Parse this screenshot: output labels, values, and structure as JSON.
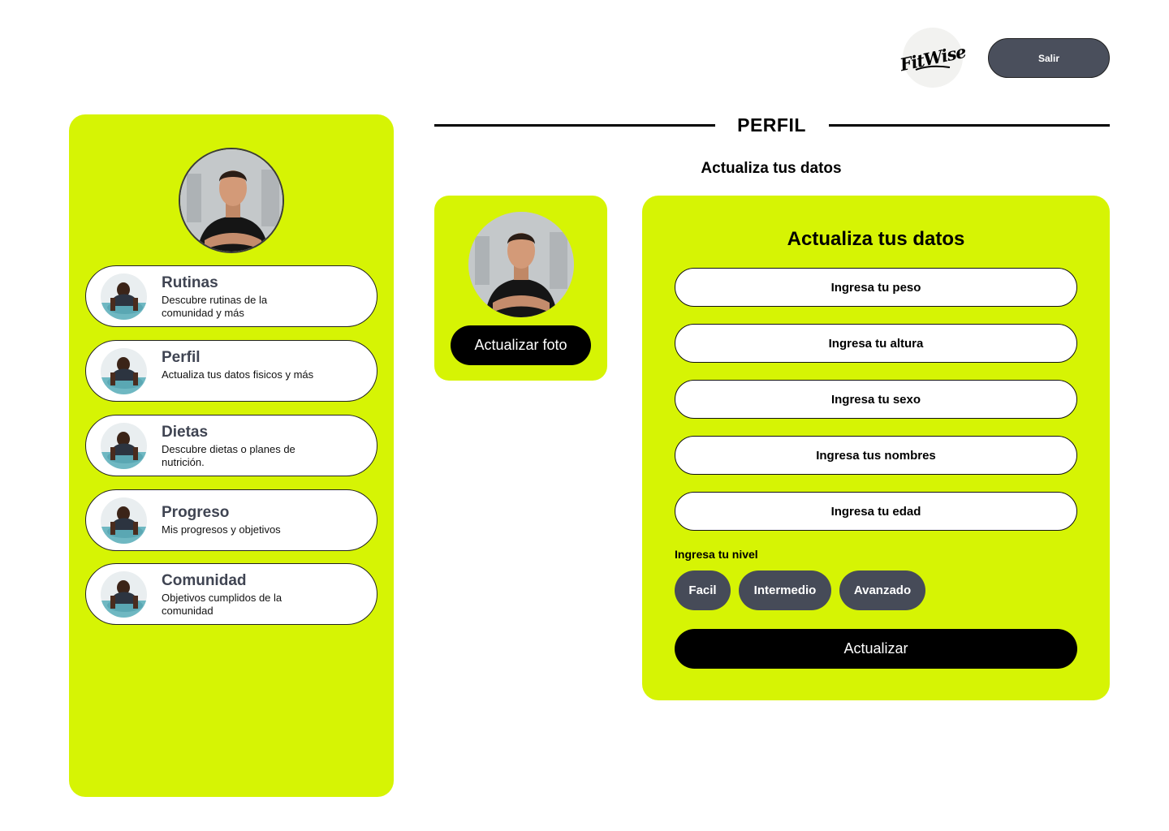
{
  "brand": {
    "logo_text": "FitWise"
  },
  "header": {
    "logout_label": "Salir"
  },
  "sidebar": {
    "items": [
      {
        "title": "Rutinas",
        "desc": "Descubre rutinas de la comunidad y más"
      },
      {
        "title": "Perfil",
        "desc": "Actualiza tus datos fisicos y más"
      },
      {
        "title": "Dietas",
        "desc": "Descubre dietas o planes de nutrición."
      },
      {
        "title": "Progreso",
        "desc": "Mis progresos y objetivos"
      },
      {
        "title": "Comunidad",
        "desc": "Objetivos cumplidos de la comunidad"
      }
    ]
  },
  "main": {
    "title": "PERFIL",
    "subtitle": "Actualiza tus datos",
    "photo_button": "Actualizar foto",
    "form": {
      "title": "Actualiza tus datos",
      "fields": [
        "Ingresa tu peso",
        "Ingresa tu altura",
        "Ingresa tu sexo",
        "Ingresa tus nombres",
        "Ingresa tu edad"
      ],
      "level_label": "Ingresa tu nivel",
      "levels": [
        "Facil",
        "Intermedio",
        "Avanzado"
      ],
      "submit": "Actualizar"
    }
  },
  "colors": {
    "accent": "#d6f404",
    "dark_button": "#464b58",
    "black": "#000000"
  }
}
